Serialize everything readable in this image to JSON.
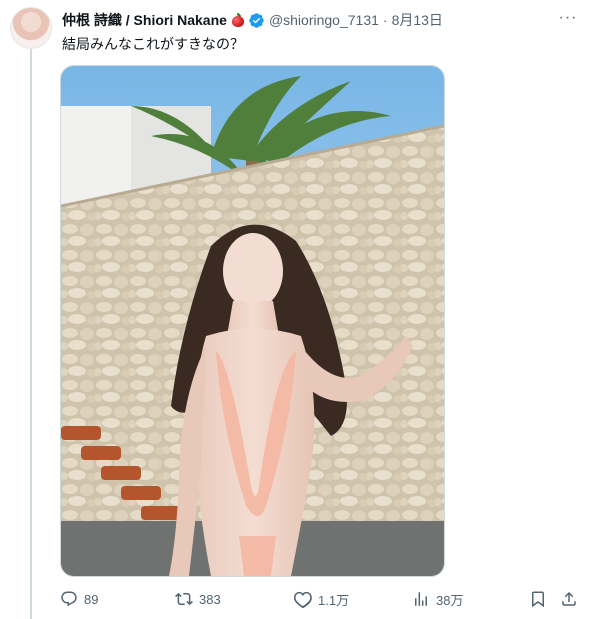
{
  "tweet": {
    "author_name": "仲根 詩織 / Shiori Nakane",
    "handle": "@shioringo_7131",
    "separator": "·",
    "date": "8月13日",
    "text": "結局みんなこれがすきなの？",
    "more_label": "···"
  },
  "actions": {
    "replies": "89",
    "reposts": "383",
    "likes": "1.1万",
    "views": "38万"
  },
  "icons": {
    "author_emoji": "red-apple-icon",
    "verified": "verified-badge-icon",
    "reply": "reply-icon",
    "repost": "repost-icon",
    "like": "heart-icon",
    "views": "views-icon",
    "bookmark": "bookmark-icon",
    "share": "share-icon"
  },
  "colors": {
    "text": "#0f1419",
    "secondary": "#536471",
    "verified": "#1d9bf0",
    "border": "#cfd9de"
  }
}
